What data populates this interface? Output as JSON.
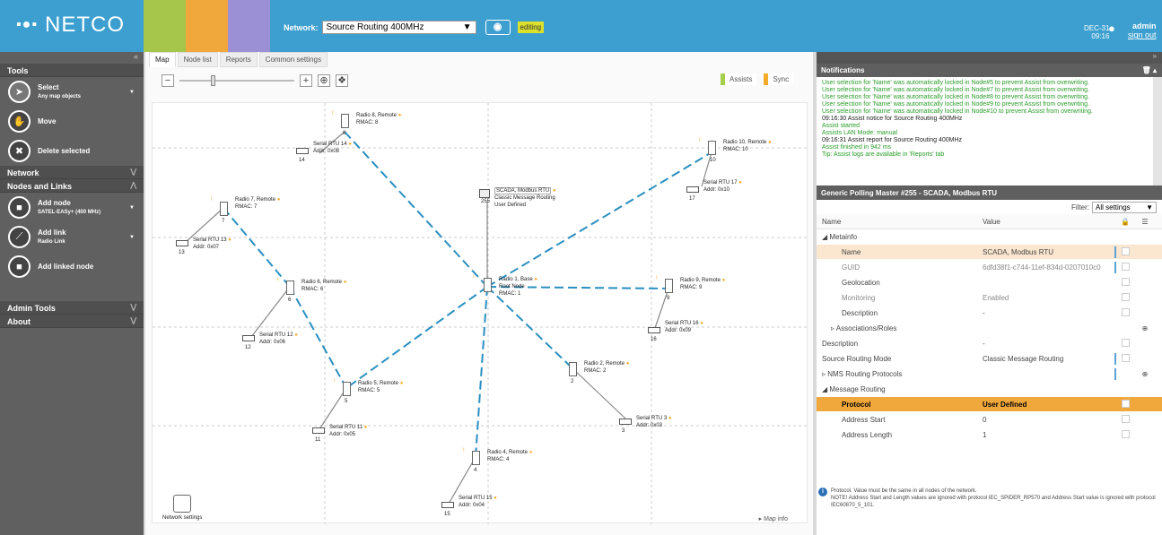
{
  "app": {
    "logo": "NETCO",
    "network_label": "Network:",
    "network_value": "Source Routing 400MHz",
    "editing": "editing",
    "date": "DEC-31",
    "time": "09:16",
    "user": "admin",
    "signout": "sign out",
    "blocks": [
      "#a5c64a",
      "#f0a73c",
      "#9b8fd6"
    ]
  },
  "sidebar": {
    "tools": "Tools",
    "select": "Select",
    "select_sub": "Any map objects",
    "move": "Move",
    "delete": "Delete selected",
    "network": "Network",
    "nodes": "Nodes and Links",
    "add_node": "Add node",
    "add_node_sub": "SATEL-EASy+ (400 MHz)",
    "add_link": "Add link",
    "add_link_sub": "Radio Link",
    "add_linked": "Add linked node",
    "admin": "Admin Tools",
    "about": "About"
  },
  "tabs": [
    "Map",
    "Node list",
    "Reports",
    "Common settings"
  ],
  "map": {
    "assists": "Assists",
    "sync": "Sync",
    "net_settings": "Network settings",
    "map_info": "Map info",
    "scada": {
      "l1": "SCADA, Modbus RTU",
      "l2": "Classic Message Routing",
      "l3": "User Defined",
      "id": "255"
    },
    "radios": [
      {
        "id": "1",
        "name": "Radio 1, Base",
        "rmac": "RMAC: 1",
        "extra": "Root Node"
      },
      {
        "id": "2",
        "name": "Radio 2, Remote",
        "rmac": "RMAC: 2"
      },
      {
        "id": "4",
        "name": "Radio 4, Remote",
        "rmac": "RMAC: 4"
      },
      {
        "id": "5",
        "name": "Radio 5, Remote",
        "rmac": "RMAC: 5"
      },
      {
        "id": "6",
        "name": "Radio 6, Remote",
        "rmac": "RMAC: 6"
      },
      {
        "id": "7",
        "name": "Radio 7, Remote",
        "rmac": "RMAC: 7"
      },
      {
        "id": "8",
        "name": "Radio 8, Remote",
        "rmac": "RMAC: 8"
      },
      {
        "id": "9",
        "name": "Radio 9, Remote",
        "rmac": "RMAC: 9"
      },
      {
        "id": "10",
        "name": "Radio 10, Remote",
        "rmac": "RMAC: 10"
      }
    ],
    "serials": [
      {
        "id": "3",
        "name": "Serial RTU 3",
        "addr": "Addr: 0x03"
      },
      {
        "id": "11",
        "name": "Serial RTU 11",
        "addr": "Addr: 0x05"
      },
      {
        "id": "12",
        "name": "Serial RTU 12",
        "addr": "Addr: 0x06"
      },
      {
        "id": "13",
        "name": "Serial RTU 13",
        "addr": "Addr: 0x07"
      },
      {
        "id": "14",
        "name": "Serial RTU 14",
        "addr": "Addr: 0x08"
      },
      {
        "id": "15",
        "name": "Serial RTU 15",
        "addr": "Addr: 0x04"
      },
      {
        "id": "16",
        "name": "Serial RTU 16",
        "addr": "Addr: 0x09"
      },
      {
        "id": "17",
        "name": "Serial RTU 17",
        "addr": "Addr: 0x10"
      }
    ]
  },
  "notifications": {
    "title": "Notifications",
    "lines": [
      {
        "t": "User selection for 'Name' was automatically locked in Node#5 to prevent Assist from overwriting.",
        "c": "g"
      },
      {
        "t": "User selection for 'Name' was automatically locked in Node#7 to prevent Assist from overwriting.",
        "c": "g"
      },
      {
        "t": "User selection for 'Name' was automatically locked in Node#8 to prevent Assist from overwriting.",
        "c": "g"
      },
      {
        "t": "User selection for 'Name' was automatically locked in Node#9 to prevent Assist from overwriting.",
        "c": "g"
      },
      {
        "t": "User selection for 'Name' was automatically locked in Node#10 to prevent Assist from overwriting.",
        "c": "g"
      },
      {
        "t": "09:16:30 Assist notice for Source Routing 400MHz",
        "c": "b"
      },
      {
        "t": "Assist started",
        "c": "g"
      },
      {
        "t": "Assists LAN Mode: manual",
        "c": "g"
      },
      {
        "t": "09:16:31 Assist report for Source Routing 400MHz",
        "c": "b"
      },
      {
        "t": "Assist finished in 942 ms",
        "c": "g"
      },
      {
        "t": "Tip: Assist logs are available in 'Reports' tab",
        "c": "g"
      }
    ]
  },
  "props": {
    "title": "Generic Polling Master #255  -  SCADA, Modbus RTU",
    "filter_label": "Filter:",
    "filter_value": "All settings",
    "col_name": "Name",
    "col_value": "Value",
    "rows": [
      {
        "n": "Metainfo",
        "v": "",
        "cls": "grp"
      },
      {
        "n": "Name",
        "v": "SCADA, Modbus RTU",
        "cls": "hl sub"
      },
      {
        "n": "GUID",
        "v": "6dfd38f1-c744-11ef-834d-0207010c0",
        "cls": "gry sub"
      },
      {
        "n": "Geolocation",
        "v": "",
        "cls": "sub"
      },
      {
        "n": "Monitoring",
        "v": "Enabled",
        "cls": "gry sub"
      },
      {
        "n": "Description",
        "v": "-",
        "cls": "sub"
      },
      {
        "n": "Associations/Roles",
        "v": "",
        "cls": "sub2"
      },
      {
        "n": "Description",
        "v": "-",
        "cls": ""
      },
      {
        "n": "Source Routing Mode",
        "v": "Classic Message Routing",
        "cls": ""
      },
      {
        "n": "NMS Routing Protocols",
        "v": "",
        "cls": ""
      },
      {
        "n": "Message Routing",
        "v": "",
        "cls": "grp"
      },
      {
        "n": "Protocol",
        "v": "User Defined",
        "cls": "sel sub"
      },
      {
        "n": "Address Start",
        "v": "0",
        "cls": "sub"
      },
      {
        "n": "Address Length",
        "v": "1",
        "cls": "sub"
      }
    ],
    "info1": "Protocol. Value must be the same in all nodes of the network.",
    "info2": "NOTE! Address Start and Length values are ignored with protocol IEC_SPIDER_RP570 and Address Start value is ignored with protocol IEC60870_5_101."
  }
}
